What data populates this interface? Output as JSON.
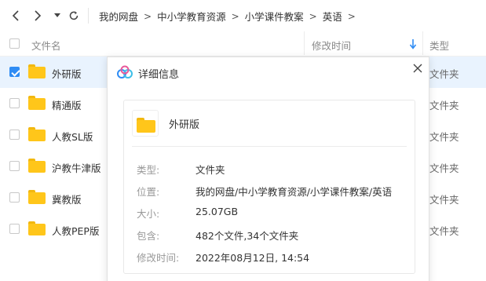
{
  "breadcrumb": {
    "items": [
      "我的网盘",
      "中小学教育资源",
      "小学课件教案",
      "英语"
    ],
    "separator": ">"
  },
  "columns": {
    "name": "文件名",
    "modified": "修改时间",
    "type": "类型"
  },
  "rows": [
    {
      "name": "外研版",
      "type": "文件夹",
      "selected": true
    },
    {
      "name": "精通版",
      "type": "文件夹",
      "selected": false
    },
    {
      "name": "人教SL版",
      "type": "文件夹",
      "selected": false
    },
    {
      "name": "沪教牛津版",
      "type": "文件夹",
      "selected": false
    },
    {
      "name": "冀教版",
      "type": "文件夹",
      "selected": false
    },
    {
      "name": "人教PEP版",
      "type": "文件夹",
      "selected": false
    }
  ],
  "dialog": {
    "title": "详细信息",
    "file_name": "外研版",
    "fields": [
      {
        "label": "类型:",
        "value": "文件夹"
      },
      {
        "label": "位置:",
        "value": "我的网盘/中小学教育资源/小学课件教案/英语"
      },
      {
        "label": "大小:",
        "value": "25.07GB"
      },
      {
        "label": "包含:",
        "value": "482个文件,34个文件夹"
      },
      {
        "label": "修改时间:",
        "value": "2022年08月12日, 14:54"
      }
    ]
  },
  "colors": {
    "accent": "#2f8cf4",
    "selected_row": "#e9f3fe",
    "folder": "#ffc61a"
  },
  "icons": {
    "back": "chevron-left-icon",
    "forward": "chevron-right-icon",
    "history": "caret-down-icon",
    "refresh": "refresh-icon",
    "sort": "sort-down-arrow-icon",
    "folder": "folder-icon",
    "logo": "baidu-netdisk-logo-icon",
    "close": "close-icon"
  }
}
